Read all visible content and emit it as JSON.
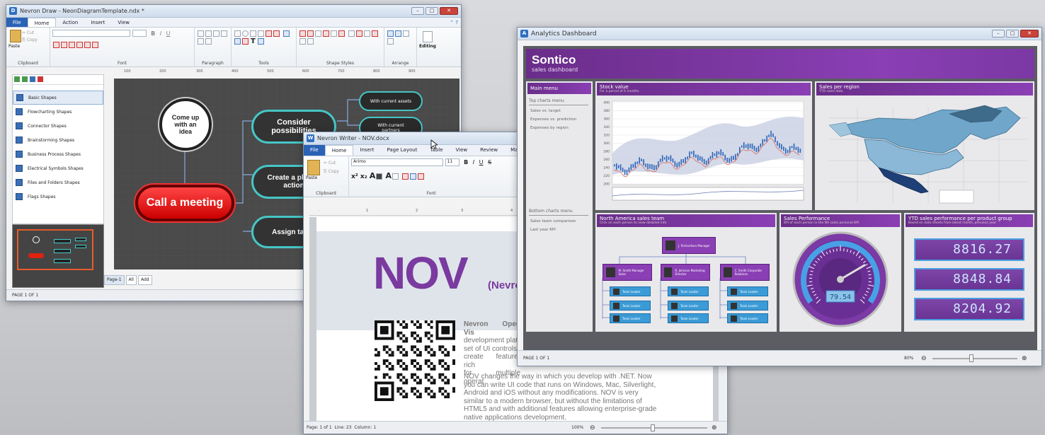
{
  "draw": {
    "title": "Nevron Draw - NeonDiagramTemplate.ndx *",
    "tabs": [
      "File",
      "Home",
      "Action",
      "Insert",
      "View"
    ],
    "clipboard": {
      "paste": "Paste",
      "cut": "Cut",
      "copy": "Copy"
    },
    "groups": [
      "Clipboard",
      "Font",
      "Paragraph",
      "Tools",
      "Shape Styles",
      "Arrange"
    ],
    "editing": "Editing",
    "libraries": [
      "Basic Shapes",
      "Flowcharting Shapes",
      "Connector Shapes",
      "Brainstorming Shapes",
      "Business Process Shapes",
      "Electrical Symbols Shapes",
      "Files and Folders Shapes",
      "Flags Shapes"
    ],
    "ruler": [
      "100",
      "200",
      "300",
      "400",
      "500",
      "600",
      "700",
      "800",
      "900"
    ],
    "nodes": {
      "center": "Come up with an idea",
      "meeting": "Call a meeting",
      "consider": "Consider possibilities",
      "plan": "Create a plan of action",
      "assign": "Assign tasks",
      "assets": "With current assets",
      "partners": "With current partners"
    },
    "page_tabs": [
      "Page-1",
      "All",
      "Add"
    ],
    "status": "PAGE 1 OF 1"
  },
  "writer": {
    "title": "Nevron Writer - NOV.docx",
    "tabs": [
      "File",
      "Home",
      "Insert",
      "Page Layout",
      "Table",
      "View",
      "Review",
      "Ma"
    ],
    "clipboard": {
      "paste": "Paste",
      "cut": "Cut",
      "copy": "Copy"
    },
    "font_name": "Arimo",
    "font_size": "11",
    "groups": [
      "Clipboard",
      "Font"
    ],
    "big_title": "NOV",
    "sub_title": "(Nevro",
    "para1": [
      "Nevron Open Vis",
      "development platf",
      "set of UI controls",
      "create feature-rich",
      "for multiple operat"
    ],
    "para2": [
      "NOV changes the way in which you develop with .NET. Now",
      "you can write UI code that runs on Windows, Mac, Silverlight,",
      "Android and iOS without any modifications. NOV is very",
      "similar to a modern browser, but without the limitations of",
      "HTML5 and with additional features allowing enterprise-grade",
      "native applications development."
    ],
    "status": {
      "page": "Page: 1 of 1",
      "line": "Line: 23",
      "column": "Column: 1",
      "zoom": "100%"
    }
  },
  "analytics": {
    "title": "Analytics Dashboard",
    "brand": "Sontico",
    "subtitle": "sales dashboard",
    "main_menu": "Main menu",
    "top_charts": "Top charts menu",
    "menu1": [
      "Sales vs. target",
      "Expenses vs. prediction",
      "Expenses by region"
    ],
    "bottom_charts": "Bottom charts menu",
    "menu2": [
      "Sales team comparison",
      "Last year KPI"
    ],
    "stock": {
      "title": "Stock value",
      "note": "For a period of 6 months",
      "y_ticks": [
        "400",
        "380",
        "360",
        "340",
        "320",
        "300",
        "280",
        "260",
        "240",
        "220",
        "200"
      ]
    },
    "region": {
      "title": "Sales per region",
      "note": "YTD sales data"
    },
    "team": {
      "title": "North America sales team",
      "note": "Click on each person to view detailed info",
      "boss": "J. Richardson Manager",
      "managers": [
        "M. Smith Manager Sales",
        "R. Johnson Marketing Director",
        "C. Smith Corporate Relations"
      ],
      "leaders": [
        "Team Leader",
        "Team Leader",
        "Team Leader",
        "Team Leader",
        "Team Leader",
        "Team Leader",
        "Team Leader",
        "Team Leader",
        "Team Leader"
      ]
    },
    "perf": {
      "title": "Sales Performance",
      "note": "KPI of each person in the NA sales personal KPI"
    },
    "ytd": {
      "title": "YTD sales performance per product group",
      "note": "Based on data sheets from latest month, previous year",
      "values": [
        "8816.27",
        "8848.84",
        "8204.92"
      ]
    },
    "gauge_value": "79.54",
    "status": "PAGE 1 OF 1",
    "zoom": "80%"
  }
}
